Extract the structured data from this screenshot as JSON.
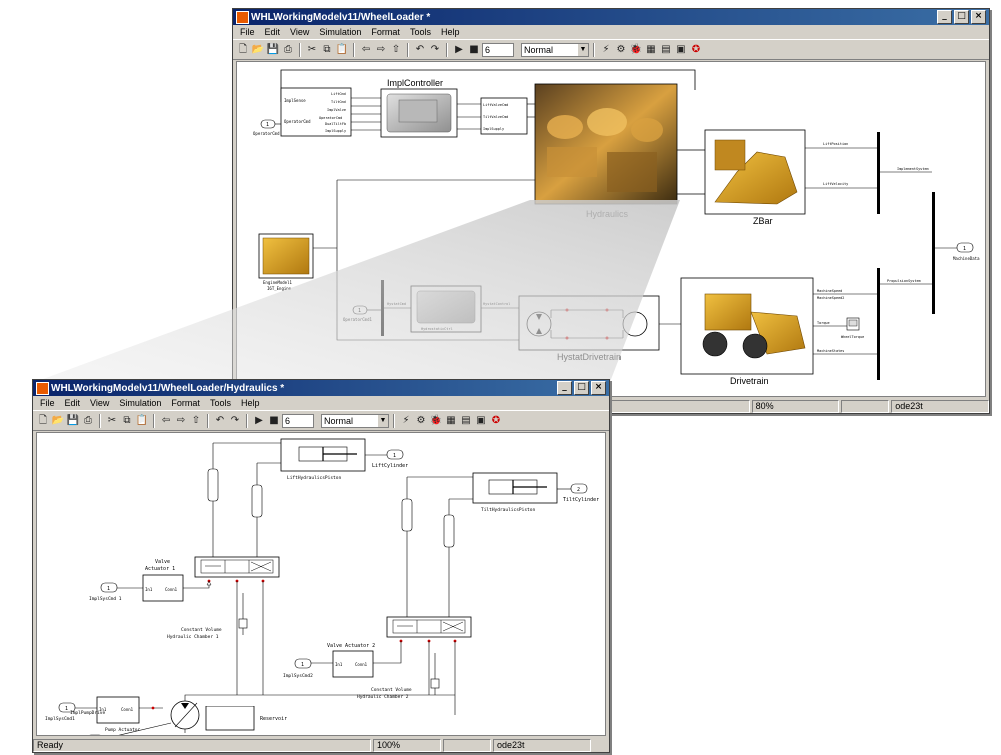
{
  "main_window": {
    "title": "WHLWorkingModelv11/WheelLoader *",
    "menu": [
      "File",
      "Edit",
      "View",
      "Simulation",
      "Format",
      "Tools",
      "Help"
    ],
    "stop_time": "6",
    "sim_mode": "Normal",
    "status": {
      "ready": "",
      "zoom": "80%",
      "solver": "ode23t"
    },
    "blocks": {
      "impl_controller": "ImplController",
      "hydraulics": "Hydraulics",
      "zbar": "ZBar",
      "hystat": "HystatDrivetrain",
      "drivetrain": "Drivetrain",
      "engine": "EngineModel1",
      "engine_sub": "I6T_Engine",
      "operator_cmd": "OperatorCmd",
      "operator_cmd1": "OperatorCmd1",
      "machine_data": "MachineData",
      "propulsion_system": "PropulsionSystem",
      "implement_system": "ImplementSystem",
      "lift_position": "LiftPosition",
      "lift_velocity": "LiftVelocity",
      "machine_speed": "MachineSpeed",
      "machine_speed2": "MachineSpeed2",
      "scope": "WheelTorque",
      "hydrostatic_ctrl": "HydrostaticCtrl",
      "hystat_port": "HystatControl",
      "hystat_cmd": "HystatCmd",
      "torque": "Torque",
      "machine_states": "MachineStates",
      "ic_in": [
        "ImplSense",
        "OperatorCmd"
      ],
      "ic_mid_in": [
        "LiftCmd",
        "TiltCmd",
        "ImplValve",
        "OperatorCmd",
        "DualTiltFb",
        "ImplSupply"
      ],
      "ic_out": [
        "LiftValveCmd",
        "TiltValveCmd",
        "ImplSupply"
      ],
      "port1": "1",
      "port2": "1"
    }
  },
  "sub_window": {
    "title": "WHLWorkingModelv11/WheelLoader/Hydraulics *",
    "menu": [
      "File",
      "Edit",
      "View",
      "Simulation",
      "Format",
      "Tools",
      "Help"
    ],
    "stop_time": "6",
    "sim_mode": "Normal",
    "status": {
      "ready": "Ready",
      "zoom": "100%",
      "solver": "ode23t"
    },
    "blocks": {
      "lift_piston": "LiftHydraulicsPiston",
      "tilt_piston": "TiltHydraulicsPiston",
      "lift_cylinder": "LiftCylinder",
      "tilt_cylinder": "TiltCylinder",
      "valve_act1_l1": "Valve",
      "valve_act1_l2": "Actuator 1",
      "valve_act2": "Valve Actuator 2",
      "cmd1": "ImplSysCmd 1",
      "cmd2": "ImplSysCmd2",
      "cmd_pump": "ImplSysCmd1",
      "pump_drive": "ImplPumpDrive",
      "pump_actuator": "Pump Actuator",
      "chamber1_l1": "Constant Volume",
      "chamber1_l2": "Hydraulic Chamber 1",
      "chamber2_l1": "Constant Volume",
      "chamber2_l2": "Hydraulic Chamber 2",
      "reservoir": "Reservoir",
      "in1": "In1",
      "conn1": "Conn1",
      "port_1": "1",
      "port_2": "2"
    }
  },
  "icons": [
    "new-file-icon",
    "open-folder-icon",
    "save-icon",
    "print-icon",
    "cut-icon",
    "copy-icon",
    "paste-icon",
    "back-icon",
    "forward-icon",
    "up-icon",
    "undo-icon",
    "redo-icon",
    "play-icon",
    "stop-icon",
    "library-icon",
    "model-explorer-icon",
    "debug-icon"
  ]
}
